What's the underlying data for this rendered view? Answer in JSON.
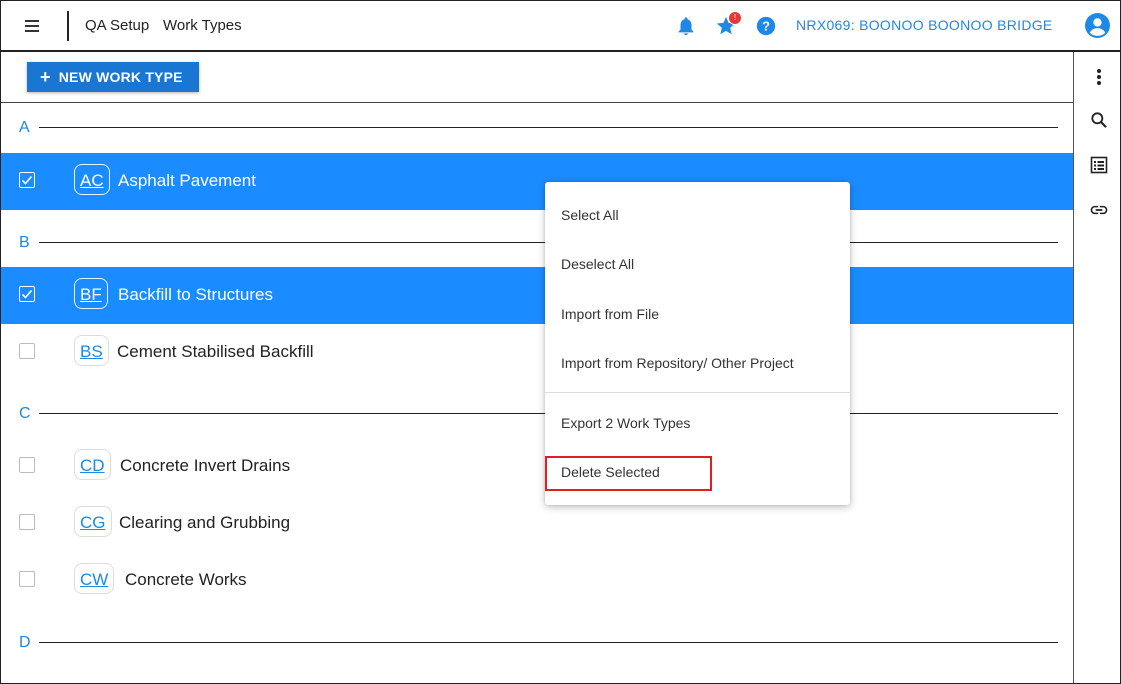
{
  "header": {
    "breadcrumb": [
      "QA Setup",
      "Work Types"
    ],
    "project": "NRX069: BOONOO BOONOO BRIDGE",
    "favorites_badge": "!",
    "accent_color": "#1e88e5",
    "icons": [
      "menu-icon",
      "bell-icon",
      "star-icon",
      "help-icon",
      "account-icon"
    ]
  },
  "toolbar": {
    "new_button_icon": "+",
    "new_button_label": "NEW WORK TYPE"
  },
  "groups": [
    {
      "letter": "A",
      "items": [
        {
          "code": "AC",
          "name": "Asphalt Pavement",
          "selected": true
        }
      ]
    },
    {
      "letter": "B",
      "items": [
        {
          "code": "BF",
          "name": "Backfill to Structures",
          "selected": true
        },
        {
          "code": "BS",
          "name": "Cement Stabilised Backfill",
          "selected": false
        }
      ]
    },
    {
      "letter": "C",
      "items": [
        {
          "code": "CD",
          "name": "Concrete Invert Drains",
          "selected": false
        },
        {
          "code": "CG",
          "name": "Clearing and Grubbing",
          "selected": false
        },
        {
          "code": "CW",
          "name": "Concrete Works",
          "selected": false
        }
      ]
    },
    {
      "letter": "D",
      "items": []
    }
  ],
  "context_menu": {
    "items": [
      "Select All",
      "Deselect All",
      "Import from File",
      "Import from Repository/ Other Project",
      "Export 2 Work Types",
      "Delete Selected"
    ],
    "highlighted": "Delete Selected",
    "highlight_color": "#e02020"
  },
  "right_sidebar": {
    "icons": [
      "more-vert-icon",
      "search-icon",
      "list-view-icon",
      "link-icon"
    ]
  },
  "colors": {
    "selected_row": "#1a8cff",
    "primary_button": "#1976d2"
  }
}
